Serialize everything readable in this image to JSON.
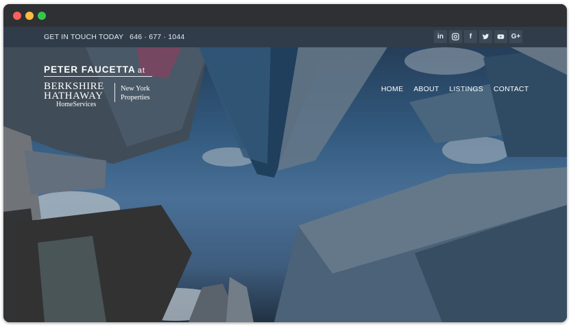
{
  "topbar": {
    "cta": "GET IN TOUCH TODAY",
    "phone": "646 · 677 · 1044",
    "social_icons": [
      "linkedin-icon",
      "instagram-icon",
      "facebook-icon",
      "twitter-icon",
      "youtube-icon",
      "google-plus-icon"
    ],
    "social_glyphs": [
      "in",
      "◎",
      "f",
      "t",
      "▶",
      "G+"
    ]
  },
  "brand": {
    "agent_name": "PETER FAUCETTA",
    "at": "at",
    "company_line1": "BERKSHIRE",
    "company_line2": "HATHAWAY",
    "company_line3": "HomeServices",
    "region_line1": "New York",
    "region_line2": "Properties"
  },
  "nav": {
    "items": [
      "HOME",
      "ABOUT",
      "LISTINGS",
      "CONTACT"
    ]
  },
  "colors": {
    "window_chrome": "#2e3033",
    "topbar": "#313c4a",
    "close": "#fc605b",
    "minimize": "#fdbc40",
    "maximize": "#34c84a"
  }
}
